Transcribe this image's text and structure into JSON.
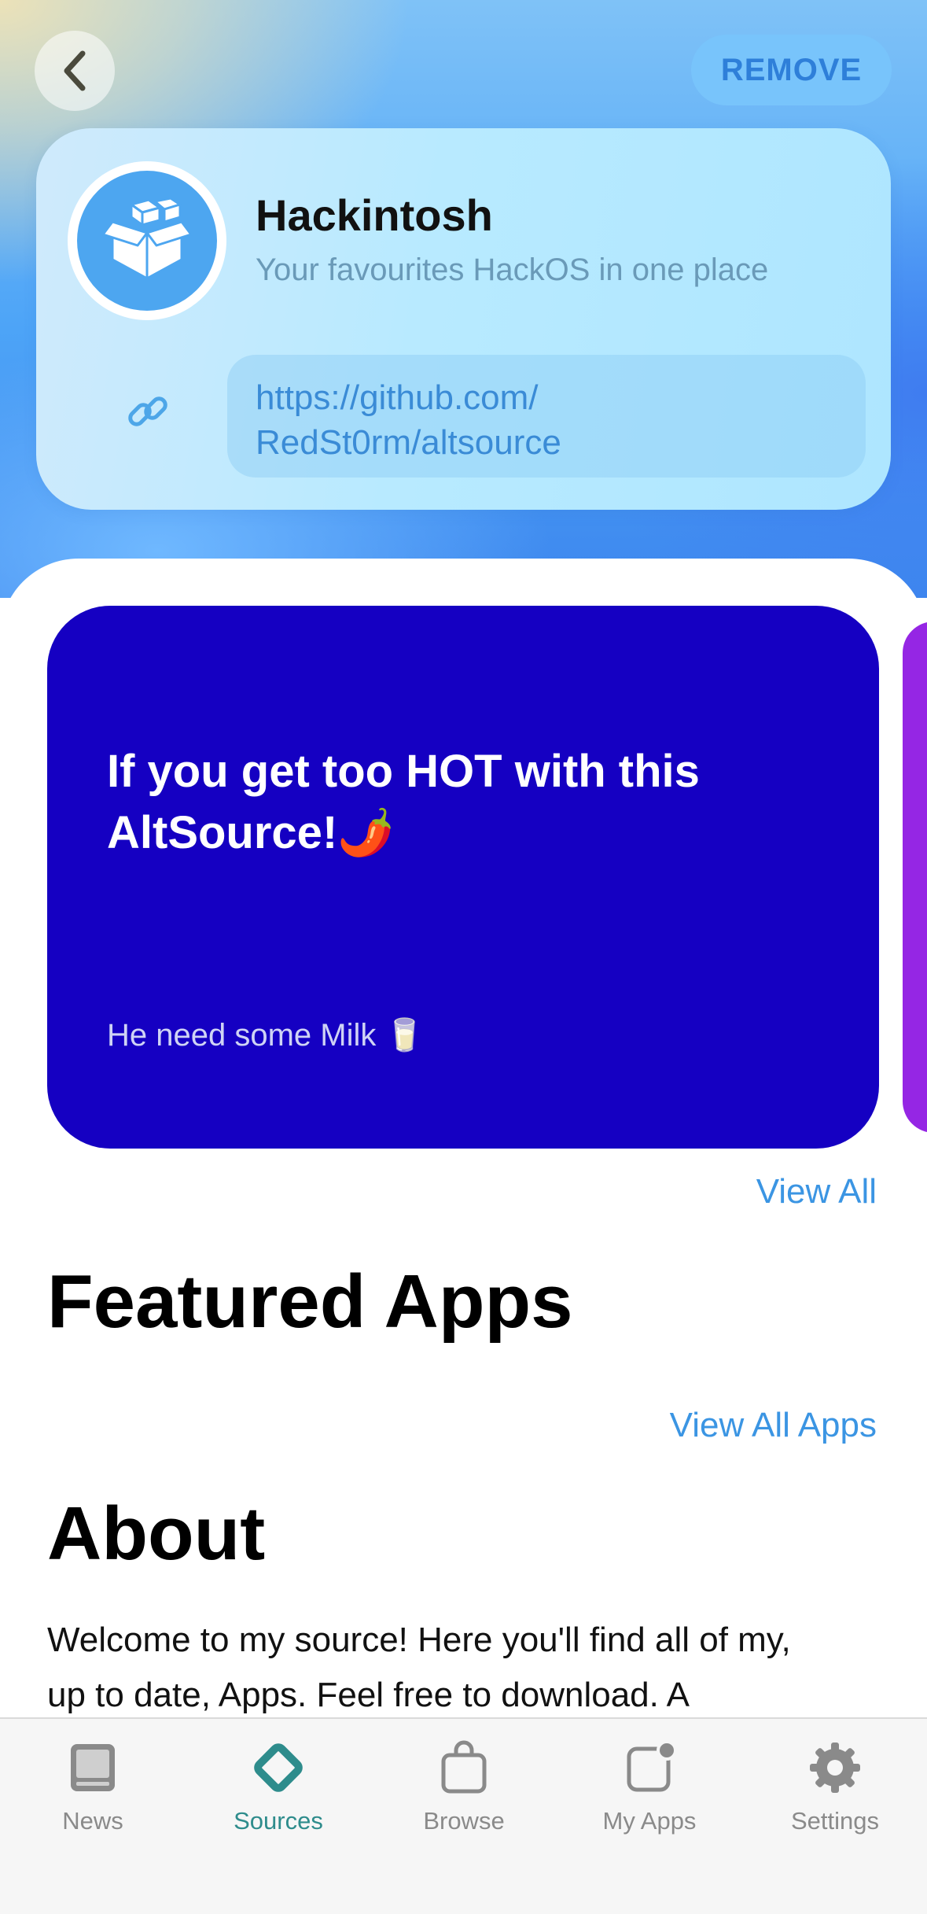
{
  "header": {
    "back_icon": "chevron-left-icon",
    "remove_label": "REMOVE"
  },
  "source": {
    "icon": "open-box-icon",
    "name": "Hackintosh",
    "subtitle": "Your favourites HackOS in one place",
    "link_icon": "link-icon",
    "url_line1": "https://github.com/",
    "url_line2": "RedSt0rm/altsource"
  },
  "news": {
    "title_line1": "If you get too HOT with this",
    "title_line2": "AltSource!🌶️",
    "caption": "He need some Milk 🥛",
    "background_color": "#1500c2",
    "next_card_color": "#9526e4",
    "view_all_label": "View All"
  },
  "featured": {
    "title": "Featured Apps",
    "view_all_label": "View All Apps"
  },
  "about": {
    "title": "About",
    "text_line1": "Welcome to my source! Here you'll find all of my,",
    "text_line2": "up to date, Apps. Feel free to download. A"
  },
  "tabs": [
    {
      "label": "News",
      "icon": "news-icon",
      "active": false
    },
    {
      "label": "Sources",
      "icon": "sources-icon",
      "active": true
    },
    {
      "label": "Browse",
      "icon": "shopping-bag-icon",
      "active": false
    },
    {
      "label": "My Apps",
      "icon": "my-apps-icon",
      "active": false
    },
    {
      "label": "Settings",
      "icon": "gear-icon",
      "active": false
    }
  ],
  "colors": {
    "accent_teal": "#2e8c8c",
    "link_blue": "#3b95e3",
    "inactive_gray": "#8a8a8a"
  }
}
